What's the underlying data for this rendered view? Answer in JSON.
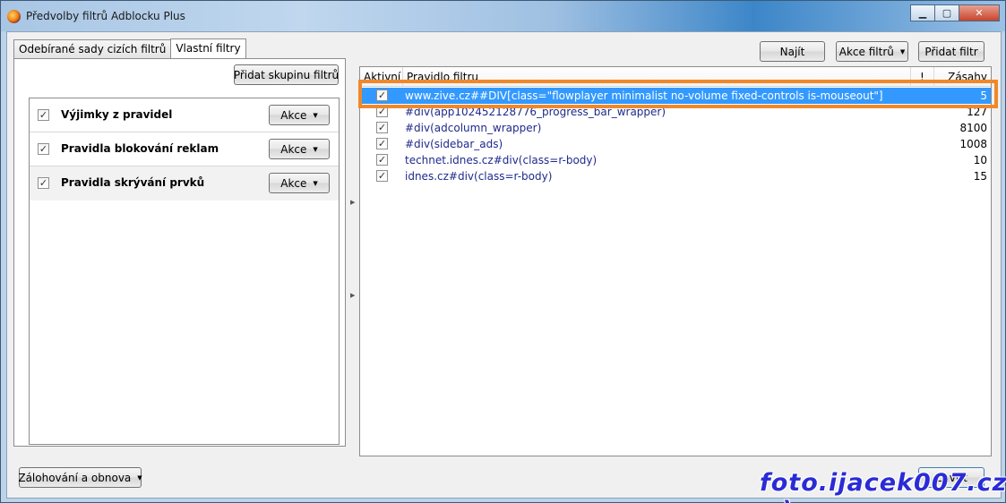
{
  "window": {
    "title": "Předvolby filtrů Adblocku Plus",
    "min_glyph": "▁",
    "max_glyph": "▢",
    "close_glyph": "✕"
  },
  "tabs": [
    {
      "label": "Odebírané sady cizích filtrů"
    },
    {
      "label": "Vlastní filtry"
    }
  ],
  "left": {
    "add_group_label": "Přidat skupinu filtrů",
    "groups": [
      {
        "label": "Výjimky z pravidel",
        "checked": "✓",
        "action": "Akce"
      },
      {
        "label": "Pravidla blokování reklam",
        "checked": "✓",
        "action": "Akce"
      },
      {
        "label": "Pravidla skrývání prvků",
        "checked": "✓",
        "action": "Akce"
      }
    ]
  },
  "toolbar": {
    "find_label": "Najít",
    "filter_actions_label": "Akce filtrů",
    "add_filter_label": "Přidat filtr"
  },
  "table": {
    "headers": {
      "active": "Aktivní",
      "rule": "Pravidlo filtru",
      "flag": "!",
      "hits": "Zásahy"
    },
    "rows": [
      {
        "checked": "✓",
        "rule": "www.zive.cz##DIV[class=\"flowplayer minimalist no-volume fixed-controls is-mouseout\"]",
        "hits": "5"
      },
      {
        "checked": "✓",
        "rule": "#div(app102452128776_progress_bar_wrapper)",
        "hits": "127"
      },
      {
        "checked": "✓",
        "rule": "#div(adcolumn_wrapper)",
        "hits": "8100"
      },
      {
        "checked": "✓",
        "rule": "#div(sidebar_ads)",
        "hits": "1008"
      },
      {
        "checked": "✓",
        "rule": "technet.idnes.cz#div(class=r-body)",
        "hits": "10"
      },
      {
        "checked": "✓",
        "rule": "idnes.cz#div(class=r-body)",
        "hits": "15"
      }
    ]
  },
  "footer": {
    "backup_label": "Zálohování a obnova",
    "close_label": "Zavřít"
  },
  "watermark": "foto.ijacek007.cz :-)",
  "colors": {
    "selection": "#3399ff",
    "highlight": "#f0882a",
    "watermark": "#2b2bd6"
  }
}
